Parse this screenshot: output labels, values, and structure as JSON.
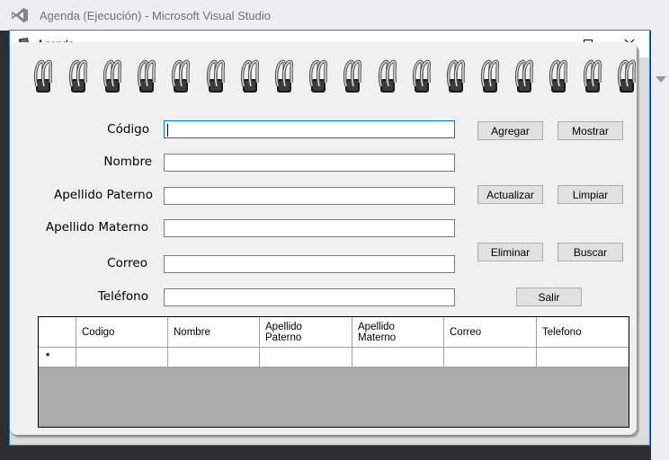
{
  "vs": {
    "title": "Agenda (Ejecución) - Microsoft Visual Studio",
    "logo_icon": "visual-studio-icon"
  },
  "window": {
    "title": "Agenda",
    "icon": "notebook-icon",
    "controls": {
      "minimize": "minimize-icon",
      "maximize": "maximize-icon",
      "close": "close-icon"
    }
  },
  "form": {
    "fields": [
      {
        "label": "Código",
        "value": ""
      },
      {
        "label": "Nombre",
        "value": ""
      },
      {
        "label": "Apellido Paterno",
        "value": ""
      },
      {
        "label": "Apellido Materno",
        "value": ""
      },
      {
        "label": "Correo",
        "value": ""
      },
      {
        "label": "Teléfono",
        "value": ""
      }
    ],
    "buttons": {
      "agregar": "Agregar",
      "mostrar": "Mostrar",
      "actualizar": "Actualizar",
      "limpiar": "Limpiar",
      "eliminar": "Eliminar",
      "buscar": "Buscar",
      "salir": "Salir"
    }
  },
  "grid": {
    "columns": [
      "Codigo",
      "Nombre",
      "Apellido Paterno",
      "Apellido Materno",
      "Correo",
      "Telefono"
    ],
    "new_row_marker": "*"
  },
  "colors": {
    "accent": "#0078d7",
    "window_border": "#1883d7",
    "grid_background": "#ababab"
  }
}
